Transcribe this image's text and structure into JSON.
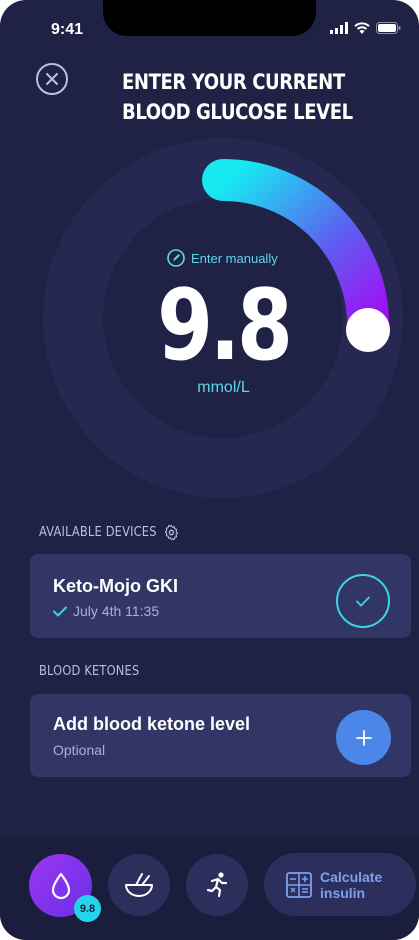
{
  "status_bar": {
    "time": "9:41"
  },
  "header": {
    "title_line1": "ENTER YOUR CURRENT",
    "title_line2": "BLOOD GLUCOSE LEVEL"
  },
  "dial": {
    "enter_manually": "Enter manually",
    "value": "9.8",
    "unit": "mmol/L",
    "colors": {
      "start": "#17e8f2",
      "end": "#a20df5"
    }
  },
  "devices": {
    "label": "AVAILABLE DEVICES",
    "card": {
      "name": "Keto-Mojo GKI",
      "sync": "July 4th 11:35"
    }
  },
  "ketones": {
    "label": "BLOOD KETONES",
    "card": {
      "title": "Add blood ketone level",
      "subtitle": "Optional"
    }
  },
  "bottom_nav": {
    "glucose_badge": "9.8",
    "calc_line1": "Calculate",
    "calc_line2": "insulin"
  }
}
